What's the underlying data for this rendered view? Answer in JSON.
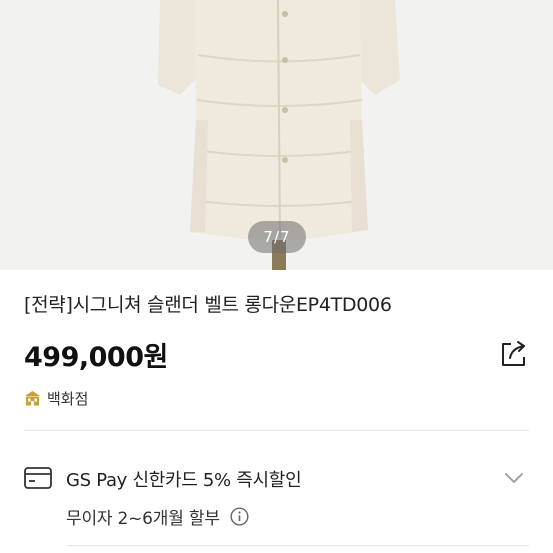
{
  "gallery": {
    "indicator": "7/7",
    "image_alt": "ivory long down coat"
  },
  "product": {
    "title": "[전략]시그니쳐 슬랜더 벨트 롱다운EP4TD006",
    "price": "499,000원",
    "store_label": "백화점"
  },
  "payment": {
    "benefit_text": "GS Pay 신한카드 5% 즉시할인",
    "installment_text": "무이자 2~6개월 할부"
  },
  "icons": {
    "share": "share-icon",
    "store": "department-store-icon",
    "card": "credit-card-icon",
    "expand": "chevron-down-icon",
    "info": "info-icon"
  },
  "colors": {
    "coat": "#efe9de",
    "store_icon": "#c9a13b",
    "pill": "#6e6e6e"
  }
}
